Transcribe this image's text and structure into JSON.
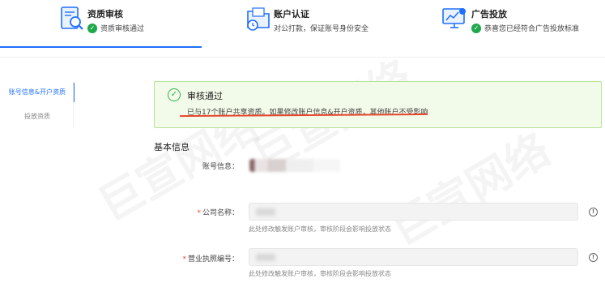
{
  "steps": [
    {
      "title": "资质审核",
      "subtitle": "资质审核通过",
      "icon": "document-search-icon",
      "done": true
    },
    {
      "title": "账户认证",
      "subtitle": "对公打款，保证账号身份安全",
      "icon": "folder-clock-icon",
      "done": false
    },
    {
      "title": "广告投放",
      "subtitle": "恭喜您已经符合广告投放标准",
      "icon": "monitor-ad-icon",
      "done": true
    }
  ],
  "sidebar": {
    "items": [
      {
        "label": "账号信息&开户资质",
        "active": true
      },
      {
        "label": "投放资质",
        "active": false
      }
    ]
  },
  "notice": {
    "title": "审核通过",
    "text": "已与17个账户共享资质。如果修改账户信息&开户资质，其他账户不受影响"
  },
  "section": {
    "title": "基本信息"
  },
  "form": {
    "account_label": "账号信息：",
    "company_label": "公司名称：",
    "company_hint": "此处修改触发账户审核，审核阶段会影响投放状态",
    "license_label": "营业执照编号：",
    "license_hint": "此处修改触发账户审核，审核阶段会影响投放状态",
    "required_mark": "*"
  },
  "watermark": "巨宣网络",
  "colors": {
    "accent": "#1f6fff",
    "success": "#1fa84a",
    "annotation": "#e8452c"
  }
}
